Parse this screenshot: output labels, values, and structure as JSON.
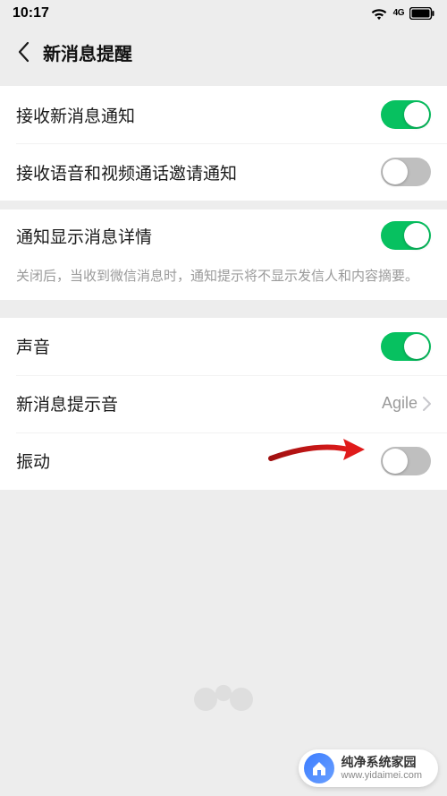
{
  "status": {
    "time": "10:17",
    "network": "4G"
  },
  "nav": {
    "title": "新消息提醒"
  },
  "rows": {
    "receive_msg": {
      "label": "接收新消息通知",
      "on": true
    },
    "receive_call": {
      "label": "接收语音和视频通话邀请通知",
      "on": false
    },
    "show_detail": {
      "label": "通知显示消息详情",
      "on": true,
      "desc": "关闭后，当收到微信消息时，通知提示将不显示发信人和内容摘要。"
    },
    "sound": {
      "label": "声音",
      "on": true
    },
    "tone": {
      "label": "新消息提示音",
      "value": "Agile"
    },
    "vibrate": {
      "label": "振动",
      "on": false
    }
  },
  "accent": {
    "on": "#07c160",
    "off": "#bfbfbf"
  },
  "watermark": {
    "title": "纯净系统家园",
    "subtitle": "www.yidaimei.com"
  }
}
